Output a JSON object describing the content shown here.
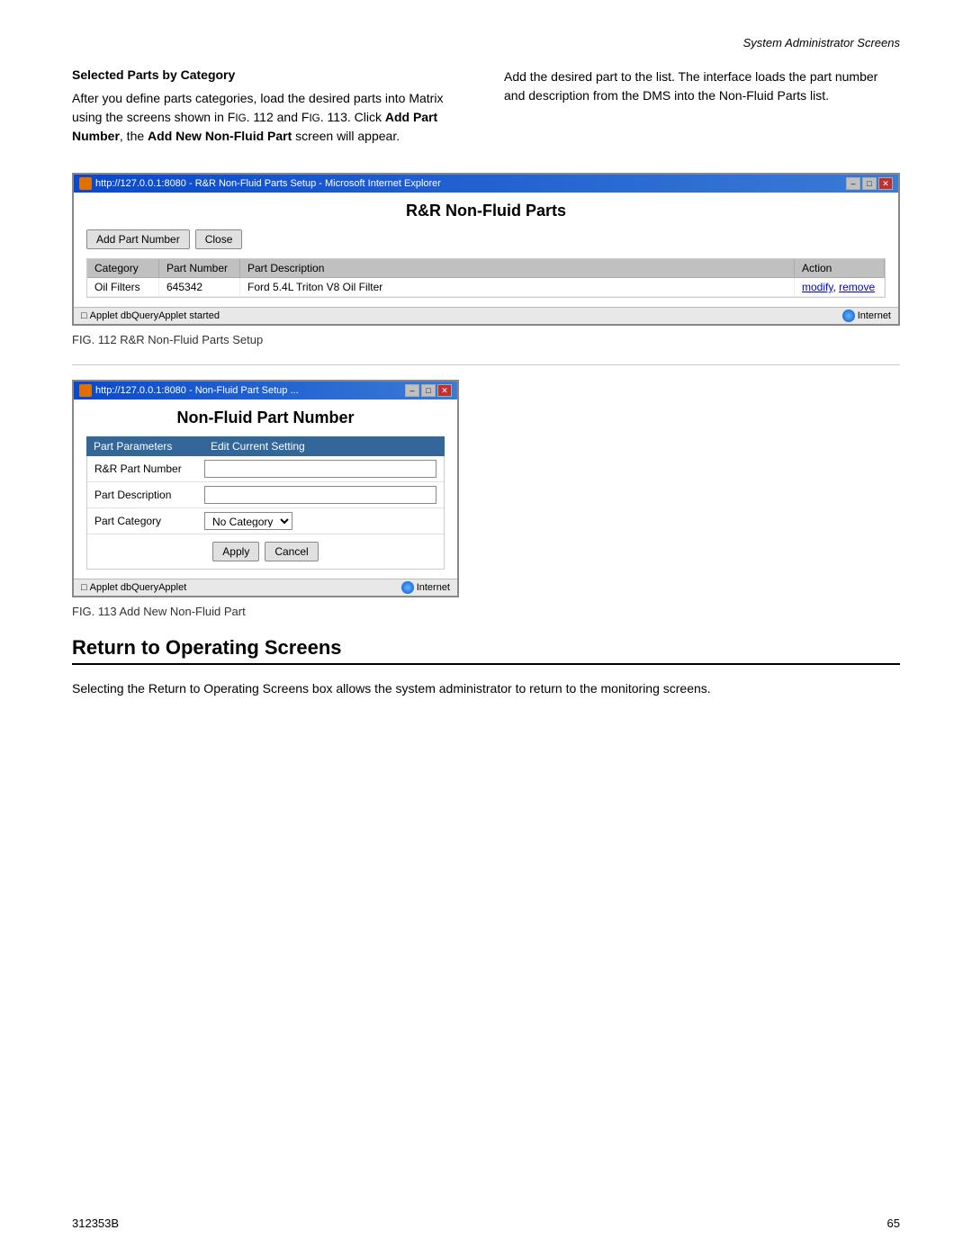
{
  "header": {
    "section_title": "System Administrator Screens"
  },
  "section1": {
    "heading": "Selected Parts by Category",
    "left_text_1": "After you define parts categories, load the desired parts into Matrix using the screens shown in F",
    "left_text_fig": "IG. 112 and F",
    "left_text_fig2": "IG.",
    "left_text_2": "113. Click ",
    "left_bold_1": "Add Part Number",
    "left_text_3": ", the ",
    "left_bold_2": "Add New Non-Fluid Part",
    "left_text_4": " screen will appear.",
    "left_paragraph": "After you define parts categories, load the desired parts into Matrix using the screens shown in FIG. 112 and FIG. 113. Click Add Part Number, the Add New Non-Fluid Part screen will appear.",
    "right_paragraph": "Add the desired part to the list. The interface loads the part number and description from the DMS into the Non-Fluid Parts list."
  },
  "fig112": {
    "title_bar": "http://127.0.0.1:8080 - R&R Non-Fluid Parts Setup - Microsoft Internet Explorer",
    "heading": "R&R Non-Fluid Parts",
    "btn_add": "Add Part Number",
    "btn_close": "Close",
    "table_headers": [
      "Category",
      "Part Number",
      "Part Description",
      "Action"
    ],
    "table_rows": [
      {
        "category": "Oil Filters",
        "part_number": "645342",
        "description": "Ford 5.4L Triton V8 Oil Filter",
        "action_modify": "modify",
        "action_sep": ", ",
        "action_remove": "remove"
      }
    ],
    "statusbar_left": "Applet dbQueryApplet started",
    "statusbar_right": "Internet",
    "caption": "FIG. 112 R&R Non-Fluid Parts Setup"
  },
  "fig113": {
    "title_bar": "http://127.0.0.1:8080 - Non-Fluid Part Setup ...",
    "heading": "Non-Fluid Part Number",
    "form_header_col1": "Part Parameters",
    "form_header_col2": "Edit Current Setting",
    "field_labels": [
      "R&R Part Number",
      "Part Description",
      "Part Category"
    ],
    "field_category_default": "No Category",
    "btn_apply": "Apply",
    "btn_cancel": "Cancel",
    "statusbar_left": "Applet dbQueryApplet",
    "statusbar_right": "Internet",
    "caption": "FIG. 113 Add New Non-Fluid Part"
  },
  "return_section": {
    "heading": "Return to Operating Screens",
    "text": "Selecting the Return to Operating Screens box allows the system administrator to return to the monitoring screens."
  },
  "footer": {
    "left": "312353B",
    "right": "65"
  }
}
